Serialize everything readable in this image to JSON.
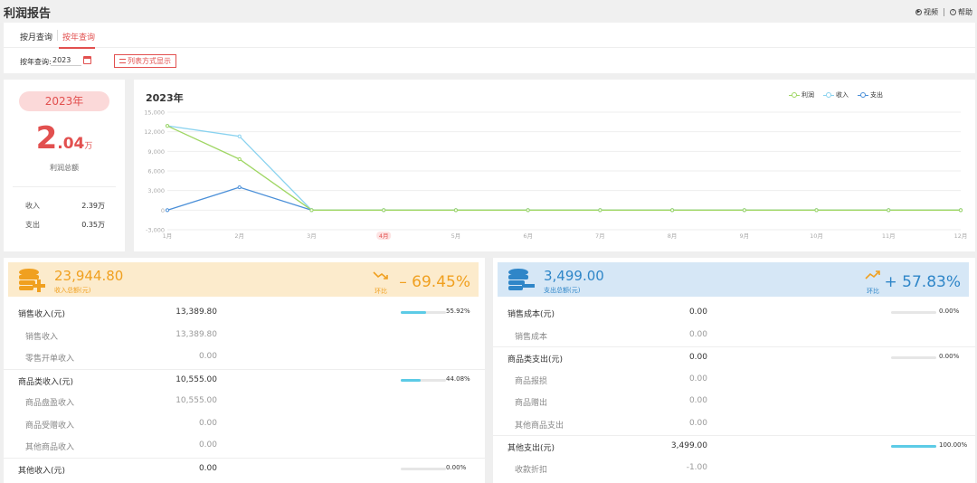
{
  "header": {
    "title": "利润报告",
    "actions": [
      {
        "label": "视频",
        "icon": "play-icon"
      },
      {
        "label": "帮助",
        "icon": "help-icon"
      }
    ]
  },
  "tabs": [
    {
      "label": "按月查询",
      "active": false
    },
    {
      "label": "按年查询",
      "active": true
    }
  ],
  "filter": {
    "label": "按年查询:",
    "year_value": "2023",
    "list_button_label": "列表方式显示"
  },
  "summary": {
    "year_label": "2023年",
    "total_whole": "2",
    "total_decimal": ".04",
    "total_unit": "万",
    "total_label": "利润总额",
    "rows": [
      {
        "label": "收入",
        "value": "2.39万"
      },
      {
        "label": "支出",
        "value": "0.35万"
      }
    ]
  },
  "colors": {
    "accent_red": "#e2504f",
    "profit_line": "#9fd663",
    "income_line": "#89d2ef",
    "expense_line": "#4a8fd8",
    "income_header_bg": "#fcebcc",
    "expense_header_bg": "#d6e7f6"
  },
  "chart_data": {
    "type": "line",
    "title": "2023年",
    "x": [
      "1月",
      "2月",
      "3月",
      "4月",
      "5月",
      "6月",
      "7月",
      "8月",
      "9月",
      "10月",
      "11月",
      "12月"
    ],
    "highlight_x": "4月",
    "ylim": [
      -3000,
      15000
    ],
    "yticks": [
      "15,000",
      "12,000",
      "9,000",
      "6,000",
      "3,000",
      "0",
      "-3,000"
    ],
    "legend_position": "top-right",
    "series": [
      {
        "name": "利润",
        "color": "#9fd663",
        "values": [
          12900,
          7800,
          0,
          0,
          0,
          0,
          0,
          0,
          0,
          0,
          0,
          0
        ]
      },
      {
        "name": "收入",
        "color": "#89d2ef",
        "values": [
          12900,
          11300,
          0,
          0,
          0,
          0,
          0,
          0,
          0,
          0,
          0,
          0
        ]
      },
      {
        "name": "支出",
        "color": "#4a8fd8",
        "values": [
          0,
          3500,
          0,
          0,
          0,
          0,
          0,
          0,
          0,
          0,
          0,
          0
        ]
      }
    ]
  },
  "income": {
    "amount": "23,944.80",
    "label": "收入总额(元)",
    "huanbi_label": "环比",
    "change": "– 69.45%",
    "rows": [
      {
        "type": "main",
        "label": "销售收入(元)",
        "value": "13,389.80",
        "pct": "55.92%",
        "ratio": 0.5592
      },
      {
        "type": "sub",
        "label": "销售收入",
        "value": "13,389.80"
      },
      {
        "type": "sub",
        "label": "零售开单收入",
        "value": "0.00"
      },
      {
        "type": "main",
        "label": "商品类收入(元)",
        "value": "10,555.00",
        "pct": "44.08%",
        "ratio": 0.4408
      },
      {
        "type": "sub",
        "label": "商品盘盈收入",
        "value": "10,555.00"
      },
      {
        "type": "sub",
        "label": "商品受赠收入",
        "value": "0.00"
      },
      {
        "type": "sub",
        "label": "其他商品收入",
        "value": "0.00"
      },
      {
        "type": "main",
        "label": "其他收入(元)",
        "value": "0.00",
        "pct": "0.00%",
        "ratio": 0
      }
    ]
  },
  "expense": {
    "amount": "3,499.00",
    "label": "支出总额(元)",
    "huanbi_label": "环比",
    "change": "+ 57.83%",
    "rows": [
      {
        "type": "main",
        "label": "销售成本(元)",
        "value": "0.00",
        "pct": "0.00%",
        "ratio": 0
      },
      {
        "type": "sub",
        "label": "销售成本",
        "value": "0.00"
      },
      {
        "type": "main",
        "label": "商品类支出(元)",
        "value": "0.00",
        "pct": "0.00%",
        "ratio": 0
      },
      {
        "type": "sub",
        "label": "商品报损",
        "value": "0.00"
      },
      {
        "type": "sub",
        "label": "商品赠出",
        "value": "0.00"
      },
      {
        "type": "sub",
        "label": "其他商品支出",
        "value": "0.00"
      },
      {
        "type": "main",
        "label": "其他支出(元)",
        "value": "3,499.00",
        "pct": "100.00%",
        "ratio": 1
      },
      {
        "type": "sub",
        "label": "收款折扣",
        "value": "-1.00"
      }
    ]
  }
}
